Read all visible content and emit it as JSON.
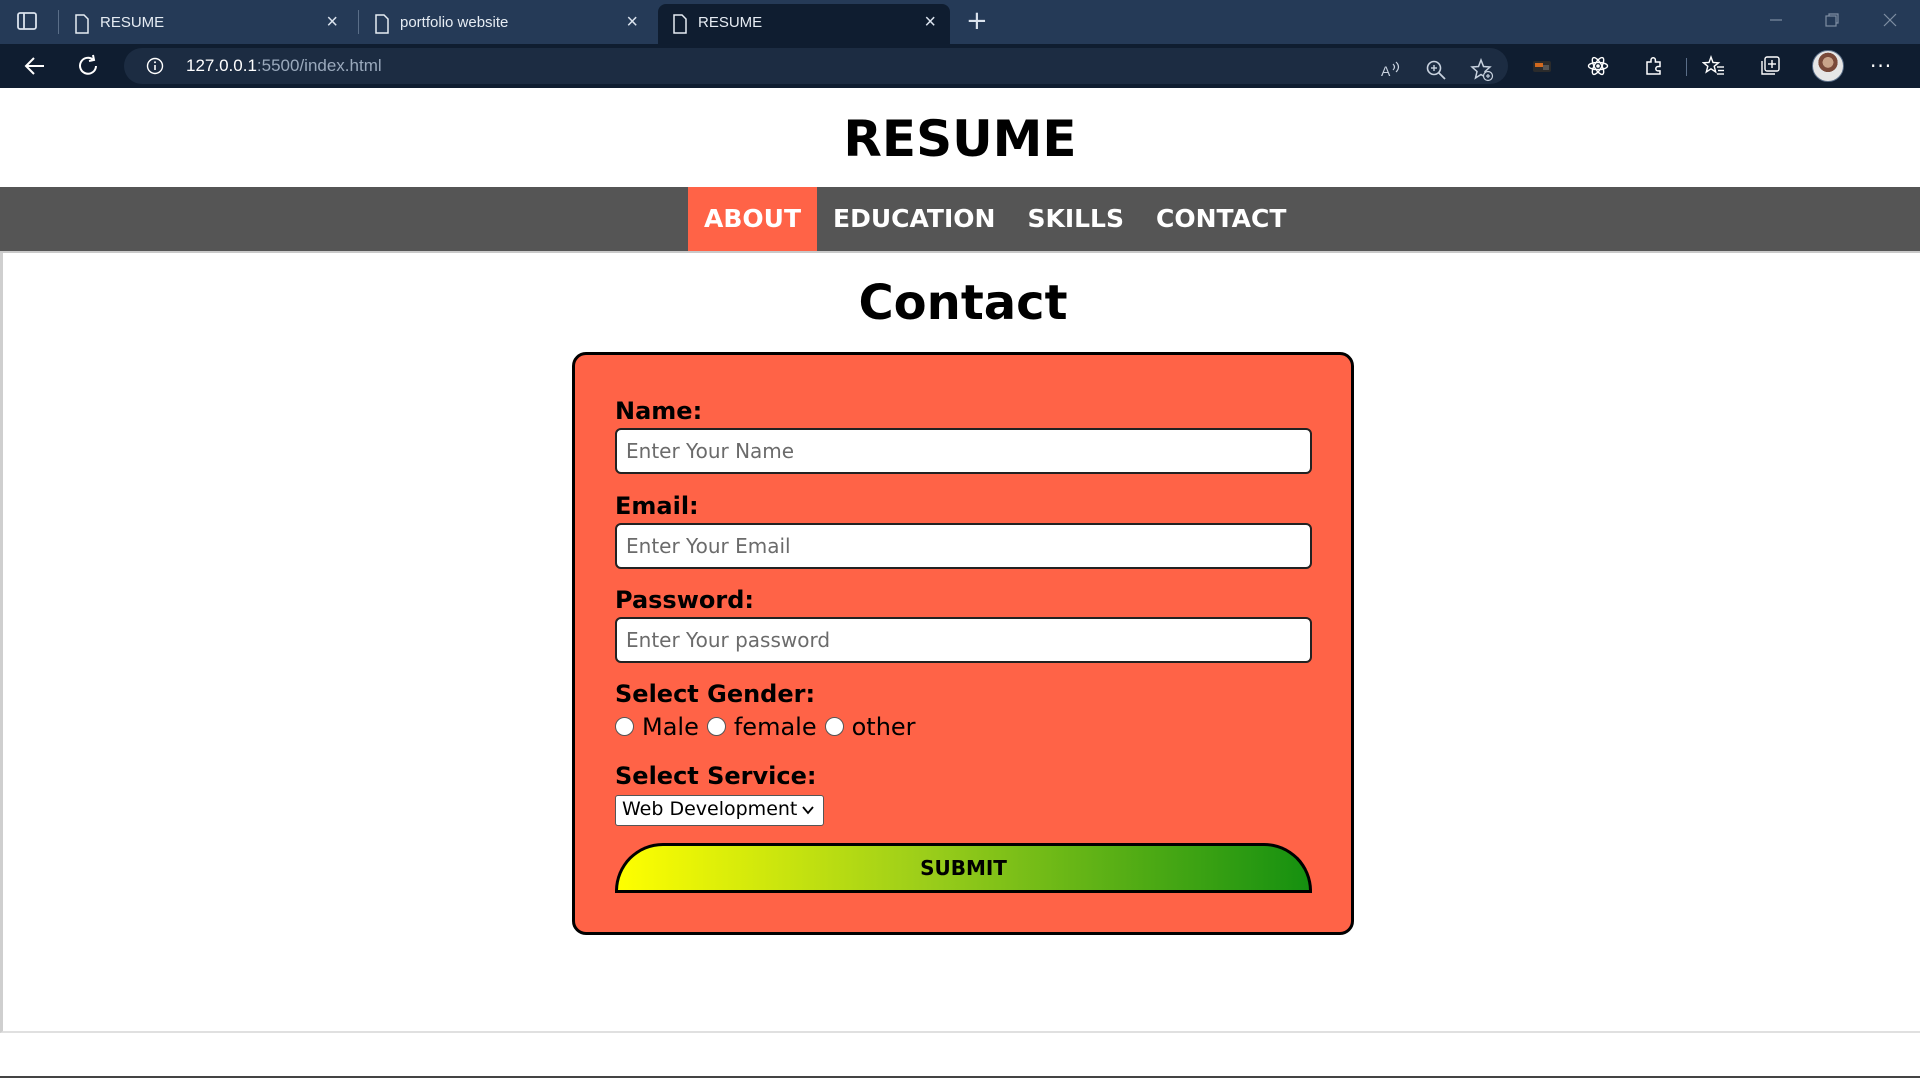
{
  "browser": {
    "tabs": [
      {
        "title": "RESUME",
        "active": false
      },
      {
        "title": "portfolio website",
        "active": false
      },
      {
        "title": "RESUME",
        "active": true
      }
    ],
    "new_tab_label": "+",
    "url_host": "127.0.0.1",
    "url_rest": ":5500/index.html",
    "toolbar_icons": [
      "read-aloud-icon",
      "zoom-icon",
      "add-favorite-icon",
      "extension-icon",
      "react-devtools-icon",
      "extensions-icon",
      "favorites-icon",
      "collections-icon",
      "profile-avatar",
      "more-icon"
    ],
    "more_label": "···"
  },
  "site": {
    "title": "RESUME",
    "nav": [
      "ABOUT",
      "EDUCATION",
      "SKILLS",
      "CONTACT"
    ],
    "active_nav": "ABOUT",
    "accent_color": "#ff6347",
    "nav_bg": "#555555"
  },
  "contact": {
    "heading": "Contact",
    "name_label": "Name:",
    "name_placeholder": "Enter Your Name",
    "email_label": "Email:",
    "email_placeholder": "Enter Your Email",
    "password_label": "Password:",
    "password_placeholder": "Enter Your password",
    "gender_label": "Select Gender:",
    "gender_options": [
      "Male",
      "female",
      "other"
    ],
    "service_label": "Select Service:",
    "service_selected": "Web Development",
    "submit_label": "SUBMIT"
  }
}
